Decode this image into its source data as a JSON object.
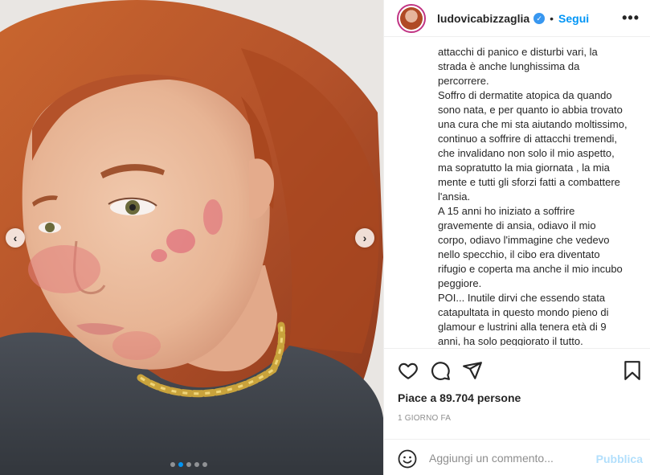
{
  "post": {
    "username": "ludovicabizzaglia",
    "verified_icon": "verified-badge-icon",
    "separator": "•",
    "follow_label": "Segui",
    "more_label": "•••",
    "caption_lines": [
      "attacchi di panico e disturbi vari, la",
      "strada è anche lunghissima da",
      "percorrere.",
      "Soffro di dermatite atopica da quando",
      "sono nata, e per quanto io abbia trovato",
      "una cura che mi sta aiutando moltissimo,",
      "continuo a soffrire di attacchi tremendi,",
      "che invalidano non solo il mio aspetto,",
      "ma sopratutto la mia giornata , la mia",
      "mente e tutti gli sforzi fatti a combattere",
      "l'ansia.",
      "A 15 anni ho iniziato a soffrire",
      "gravemente di ansia, odiavo il mio",
      "corpo, odiavo l'immagine che vedevo",
      "nello specchio, il cibo era diventato",
      "rifugio e coperta ma anche il mio incubo",
      "peggiore.",
      "POI... Inutile dirvi che essendo stata",
      "catapultata in questo mondo pieno di",
      "glamour e lustrini alla tenera età di 9",
      "anni, ha solo peggiorato il tutto."
    ],
    "likes_text": "Piace a 89.704 persone",
    "time_text": "1 GIORNO FA",
    "comment_placeholder": "Aggiungi un commento...",
    "publish_label": "Pubblica"
  },
  "carousel": {
    "prev_label": "‹",
    "next_label": "›",
    "slide_count": 5,
    "active_index": 1
  },
  "colors": {
    "accent": "#0095f6",
    "publish_disabled": "#b2dffc",
    "muted": "#8e8e8e",
    "border": "#efefef"
  }
}
